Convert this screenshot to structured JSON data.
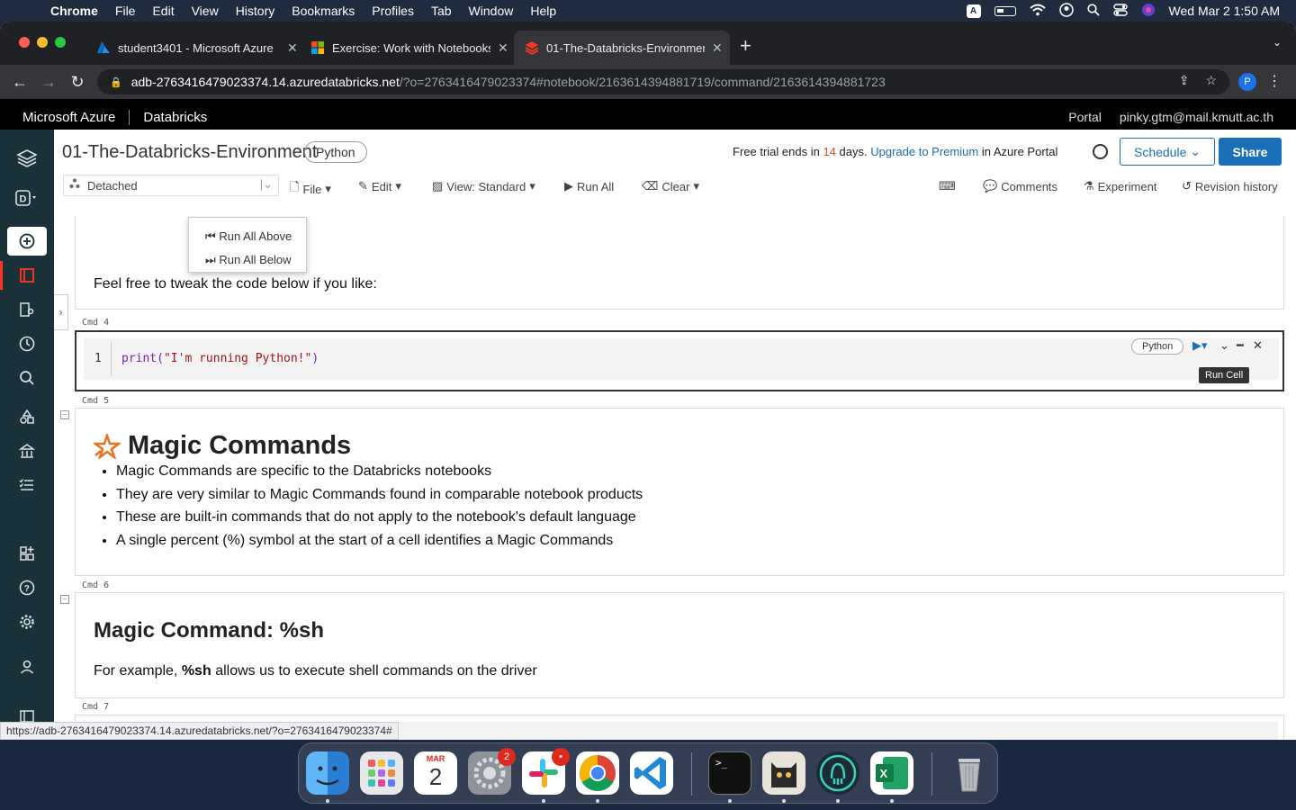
{
  "menubar": {
    "app": "Chrome",
    "items": [
      "File",
      "Edit",
      "View",
      "History",
      "Bookmarks",
      "Profiles",
      "Tab",
      "Window",
      "Help"
    ],
    "input_source": "A",
    "datetime": "Wed Mar 2  1:50 AM"
  },
  "tabs": [
    {
      "title": "student3401 - Microsoft Azure",
      "active": false
    },
    {
      "title": "Exercise: Work with Notebooks",
      "active": false
    },
    {
      "title": "01-The-Databricks-Environment",
      "active": true
    }
  ],
  "address": {
    "host": "adb-2763416479023374.14.azuredatabricks.net",
    "path": "/?o=2763416479023374#notebook/2163614394881719/command/2163614394881723",
    "profile_initial": "P"
  },
  "azure_header": {
    "brand": "Microsoft Azure",
    "product": "Databricks",
    "portal": "Portal",
    "user": "pinky.gtm@mail.kmutt.ac.th"
  },
  "notebook": {
    "title": "01-The-Databricks-Environment",
    "language": "Python",
    "trial_prefix": "Free trial ends in",
    "trial_days": "14",
    "trial_days_suffix": "days.",
    "trial_link": "Upgrade to Premium",
    "trial_suffix": "in Azure Portal",
    "schedule_label": "Schedule",
    "share_label": "Share"
  },
  "toolbar": {
    "cluster": "Detached",
    "file": "File",
    "edit": "Edit",
    "view": "View: Standard",
    "run_all": "Run All",
    "clear": "Clear",
    "comments": "Comments",
    "experiment": "Experiment",
    "revision": "Revision history"
  },
  "run_menu": {
    "above": "Run All Above",
    "below": "Run All Below"
  },
  "cells": {
    "cell3_text": "Feel free to tweak the code below if you like:",
    "cmd4": "Cmd  4",
    "code_line": "1",
    "code_fn": "print(",
    "code_str": "\"I'm running Python!\"",
    "code_close": ")",
    "cell_lang": "Python",
    "tooltip": "Run Cell",
    "cmd5": "Cmd  5",
    "magic_title": "Magic Commands",
    "magic_bullets": [
      "Magic Commands are specific to the Databricks notebooks",
      "They are very similar to Magic Commands found in comparable notebook products",
      "These are built-in commands that do not apply to the notebook's default language",
      "A single percent (%) symbol at the start of a cell identifies a Magic Commands"
    ],
    "cmd6": "Cmd  6",
    "sh_title": "Magic Command: %sh",
    "sh_prefix": "For example,",
    "sh_bold": "%sh",
    "sh_suffix": "allows us to execute shell commands on the driver",
    "cmd7": "Cmd  7"
  },
  "status_url": "https://adb-2763416479023374.14.azuredatabricks.net/?o=2763416479023374#",
  "dock": {
    "calendar_month": "MAR",
    "calendar_day": "2",
    "settings_badge": "2",
    "slack_badge": "•"
  },
  "colors": {
    "azure_blue": "#1a6fb7",
    "databricks_red": "#ff3621",
    "sidebar": "#1b3139"
  }
}
